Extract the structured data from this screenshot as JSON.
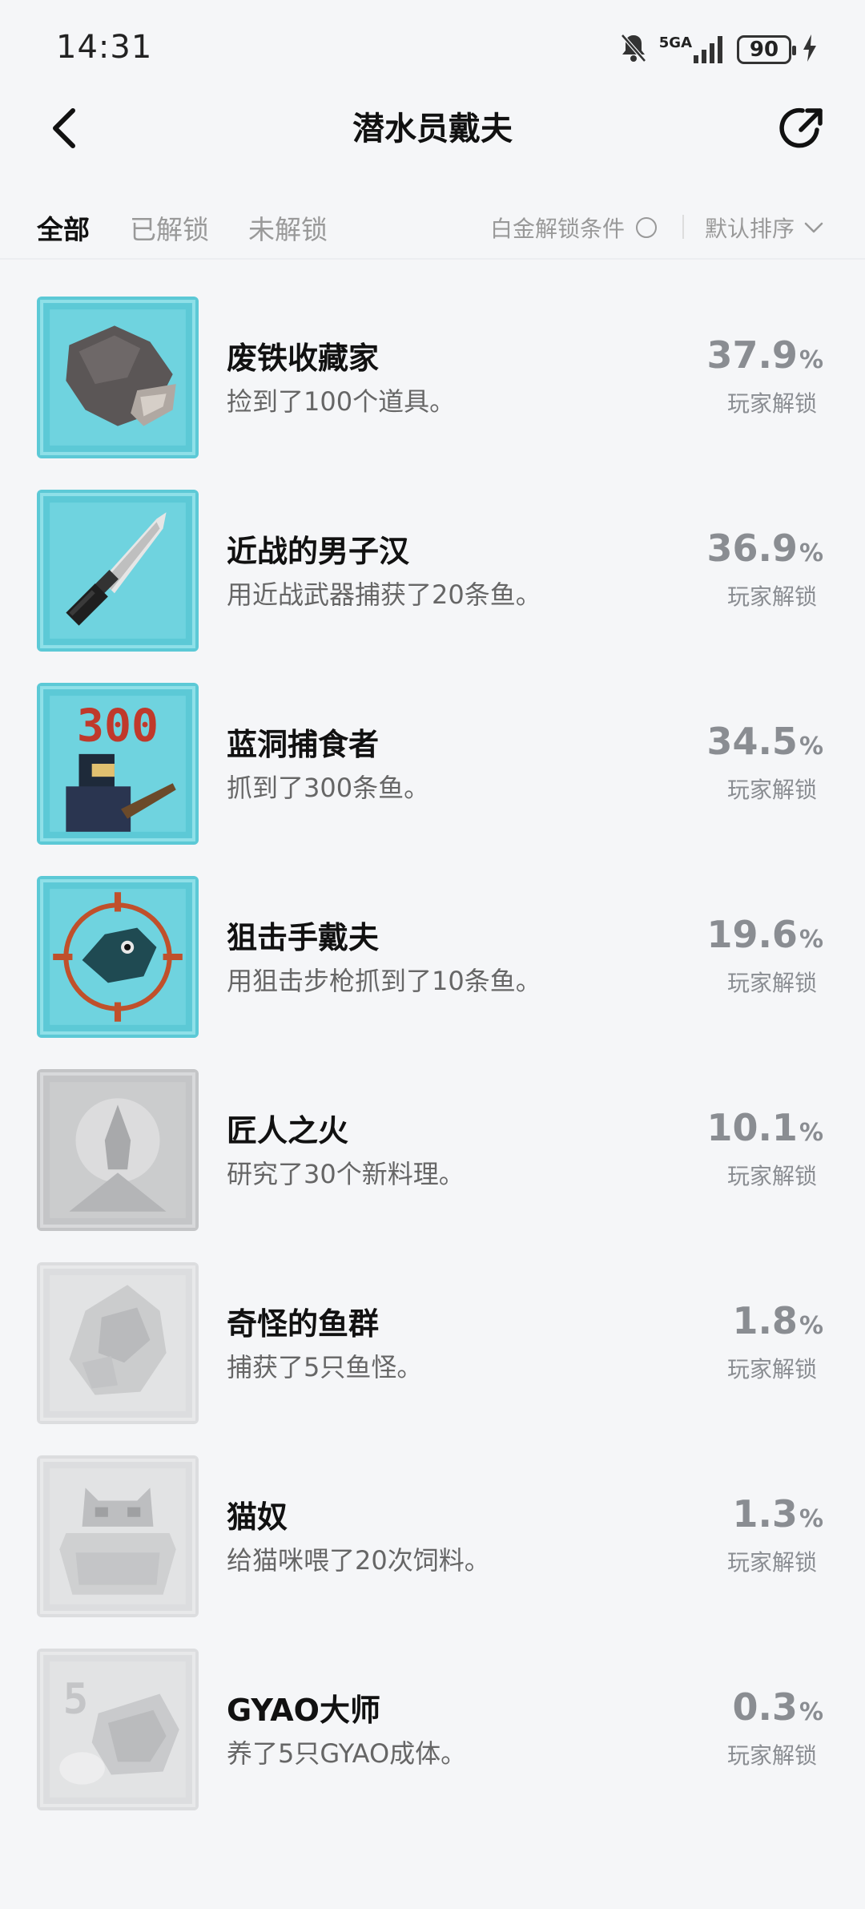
{
  "status_bar": {
    "time": "14:31",
    "network": "5GA",
    "battery": "90"
  },
  "nav": {
    "title": "潜水员戴夫"
  },
  "filters": {
    "tabs": [
      "全部",
      "已解锁",
      "未解锁"
    ],
    "active_tab": "全部",
    "platinum_label": "白金解锁条件",
    "sort_label": "默认排序"
  },
  "achievements": [
    {
      "name": "废铁收藏家",
      "desc": "捡到了100个道具。",
      "rate": "37.9",
      "unit": "%",
      "rate_label": "玩家解锁",
      "unlocked": true,
      "icon": "scrap-metal-icon"
    },
    {
      "name": "近战的男子汉",
      "desc": "用近战武器捕获了20条鱼。",
      "rate": "36.9",
      "unit": "%",
      "rate_label": "玩家解锁",
      "unlocked": true,
      "icon": "knife-icon"
    },
    {
      "name": "蓝洞捕食者",
      "desc": "抓到了300条鱼。",
      "rate": "34.5",
      "unit": "%",
      "rate_label": "玩家解锁",
      "unlocked": true,
      "icon": "diver-300-icon"
    },
    {
      "name": "狙击手戴夫",
      "desc": "用狙击步枪抓到了10条鱼。",
      "rate": "19.6",
      "unit": "%",
      "rate_label": "玩家解锁",
      "unlocked": true,
      "icon": "crosshair-fish-icon"
    },
    {
      "name": "匠人之火",
      "desc": "研究了30个新料理。",
      "rate": "10.1",
      "unit": "%",
      "rate_label": "玩家解锁",
      "unlocked": false,
      "icon": "flame-icon"
    },
    {
      "name": "奇怪的鱼群",
      "desc": "捕获了5只鱼怪。",
      "rate": "1.8",
      "unit": "%",
      "rate_label": "玩家解锁",
      "unlocked": false,
      "icon": "fish-monster-icon"
    },
    {
      "name": "猫奴",
      "desc": "给猫咪喂了20次饲料。",
      "rate": "1.3",
      "unit": "%",
      "rate_label": "玩家解锁",
      "unlocked": false,
      "icon": "cat-box-icon"
    },
    {
      "name": "GYAO大师",
      "desc": "养了5只GYAO成体。",
      "rate": "0.3",
      "unit": "%",
      "rate_label": "玩家解锁",
      "unlocked": false,
      "icon": "gyao-icon"
    }
  ],
  "colors": {
    "unlocked_bg": "#5cc9d6",
    "locked_bg": "#cfd0d2",
    "rate_text": "#8a8d92"
  }
}
